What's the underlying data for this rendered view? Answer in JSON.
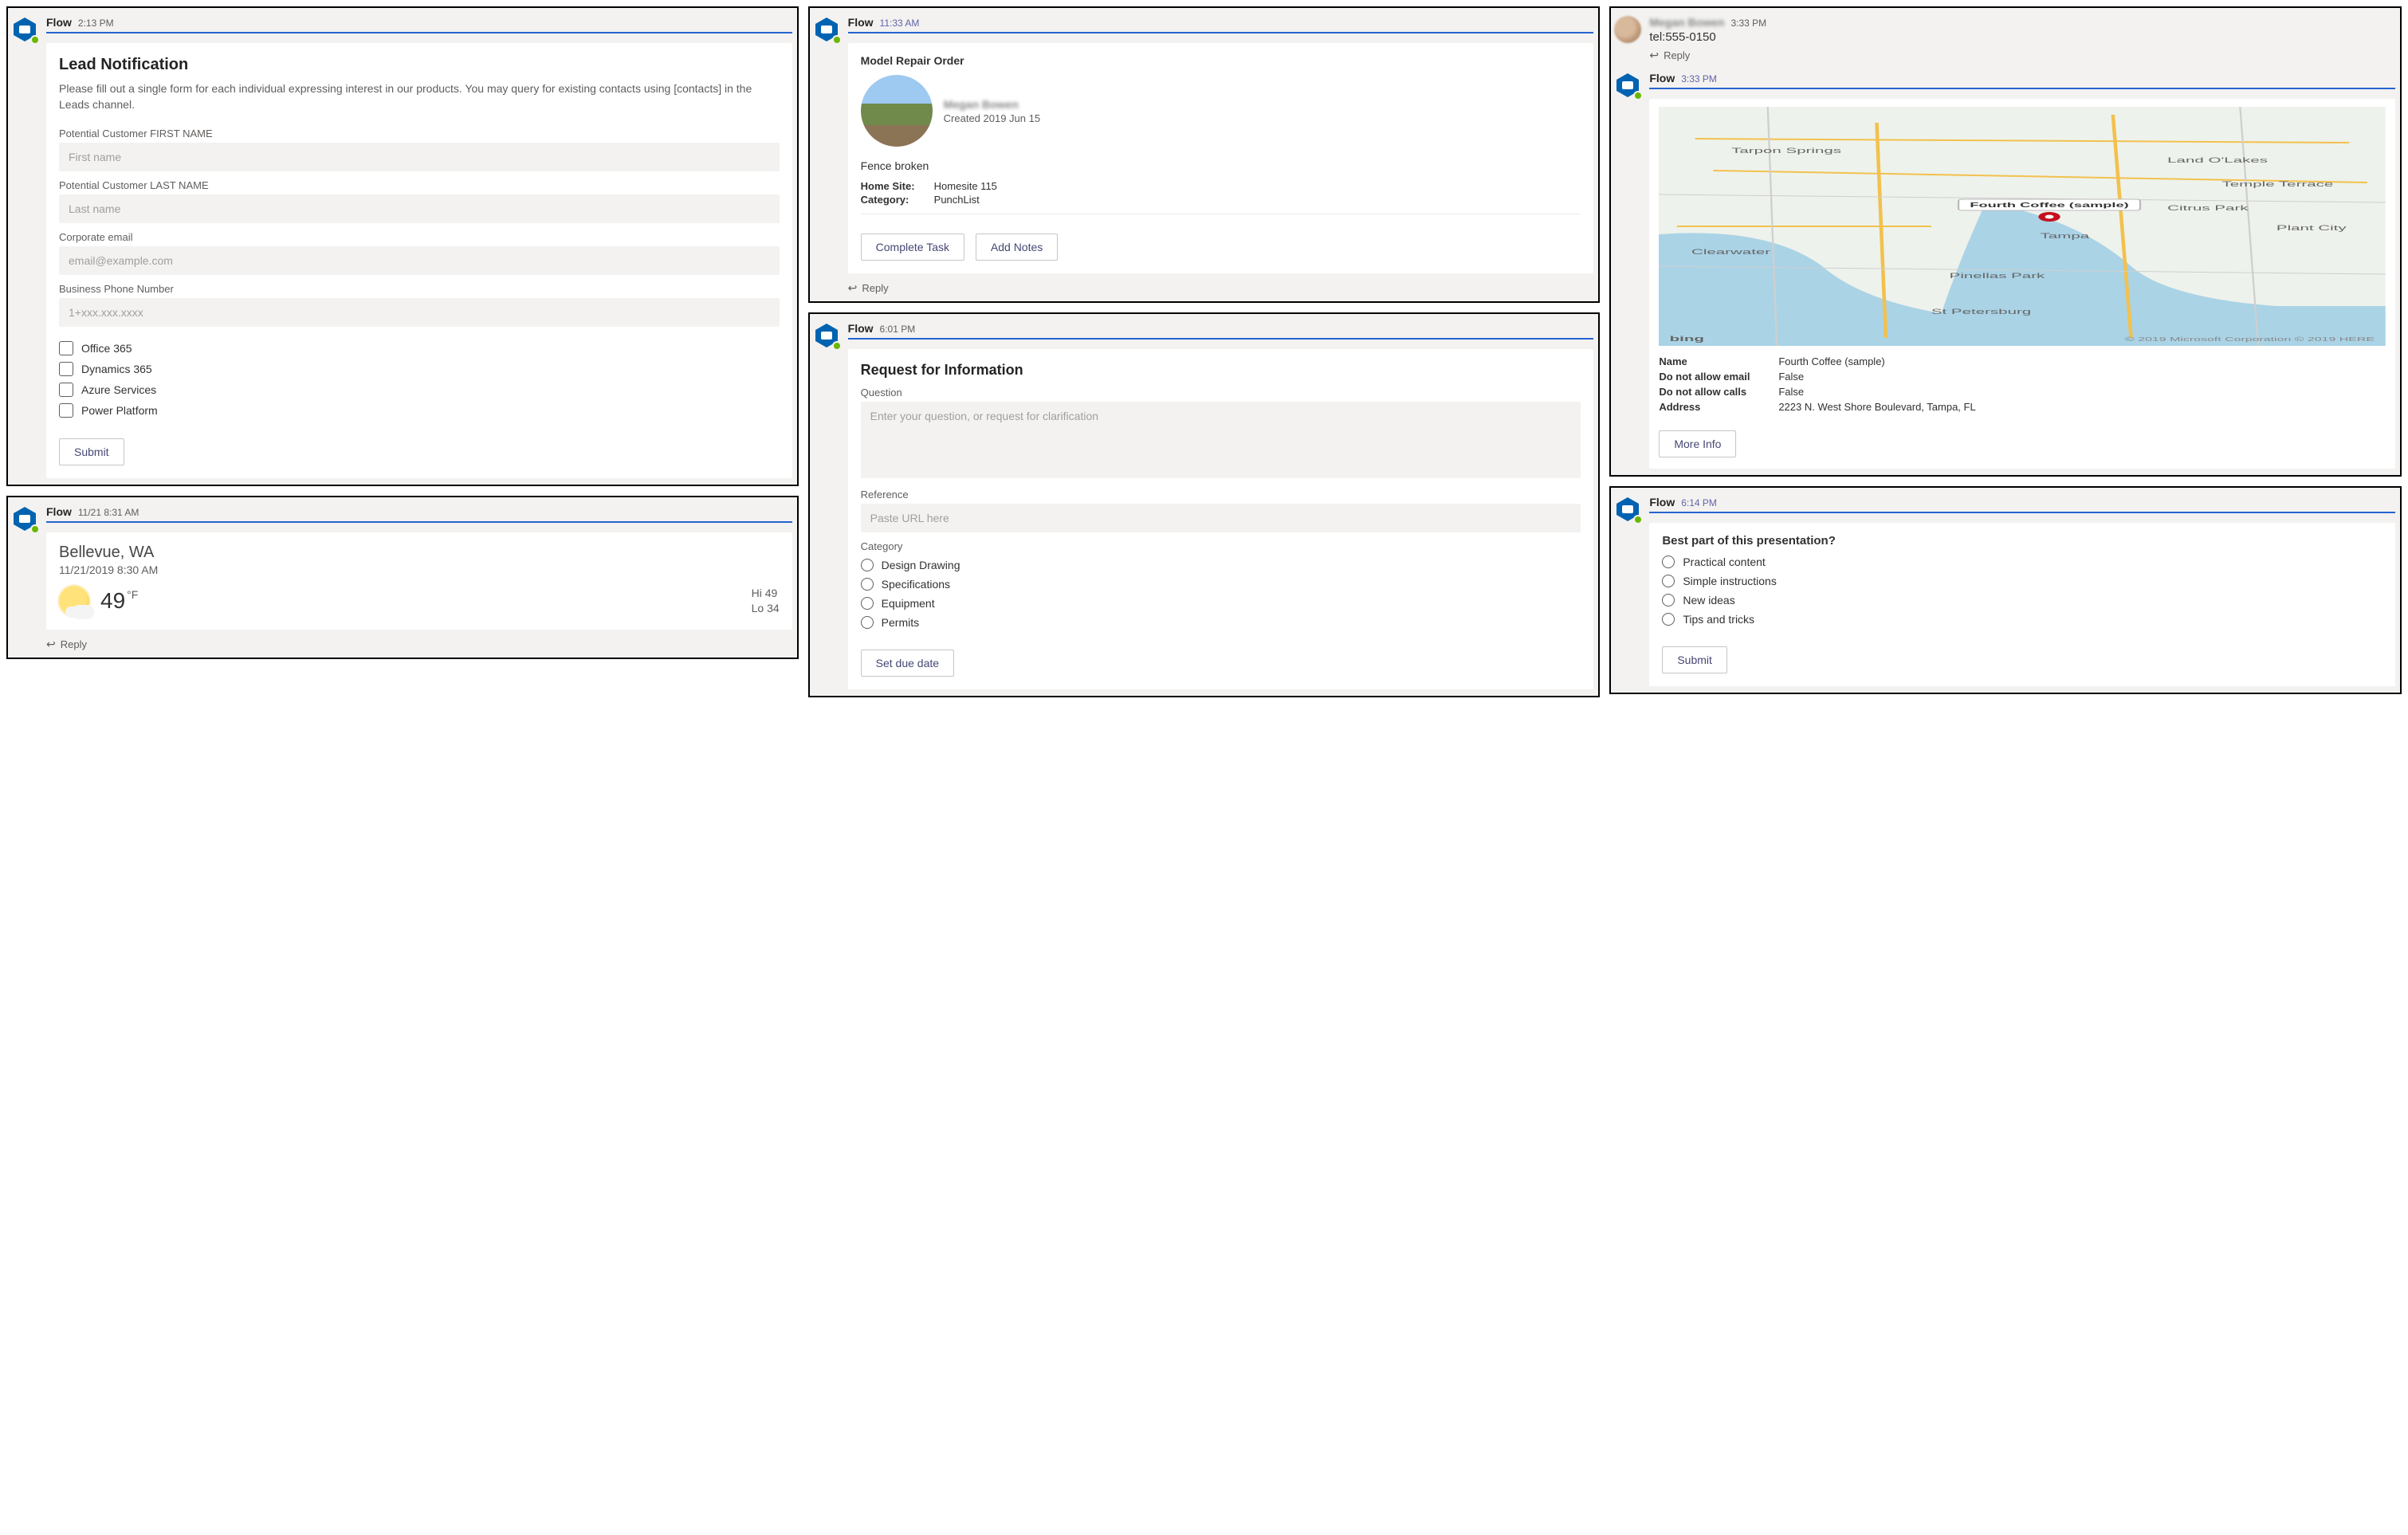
{
  "flow_label": "Flow",
  "reply_label": "Reply",
  "card1": {
    "time": "2:13 PM",
    "title": "Lead Notification",
    "desc": "Please fill out a single form for each individual expressing interest in our products. You may query for existing contacts using [contacts] in the Leads channel.",
    "labels": {
      "first": "Potential Customer FIRST NAME",
      "last": "Potential Customer LAST NAME",
      "email": "Corporate email",
      "phone": "Business Phone Number"
    },
    "placeholders": {
      "first": "First name",
      "last": "Last name",
      "email": "email@example.com",
      "phone": "1+xxx.xxx.xxxx"
    },
    "checks": [
      "Office 365",
      "Dynamics 365",
      "Azure Services",
      "Power Platform"
    ],
    "submit": "Submit"
  },
  "card2": {
    "time": "11/21 8:31 AM",
    "location": "Bellevue, WA",
    "datetime": "11/21/2019 8:30 AM",
    "temp": "49",
    "unit": "°F",
    "hi": "Hi 49",
    "lo": "Lo 34"
  },
  "card3": {
    "time": "11:33 AM",
    "title": "Model Repair Order",
    "creator": "Megan Bowen",
    "created": "Created 2019 Jun 15",
    "issue": "Fence broken",
    "homesite_k": "Home Site:",
    "homesite_v": "Homesite 115",
    "category_k": "Category:",
    "category_v": "PunchList",
    "btn_complete": "Complete Task",
    "btn_notes": "Add Notes"
  },
  "card4": {
    "time": "6:01 PM",
    "title": "Request for Information",
    "question_label": "Question",
    "question_ph": "Enter your question, or request for clarification",
    "reference_label": "Reference",
    "reference_ph": "Paste URL here",
    "category_label": "Category",
    "radios": [
      "Design Drawing",
      "Specifications",
      "Equipment",
      "Permits"
    ],
    "btn_due": "Set due date"
  },
  "card5a": {
    "sender": "Megan Bowen",
    "time": "3:33 PM",
    "tel": "tel:555-0150"
  },
  "card5b": {
    "time": "3:33 PM",
    "map_attribution_left": "bing",
    "map_attribution_right": "© 2019 Microsoft Corporation © 2019 HERE",
    "pin_label": "Fourth Coffee (sample)",
    "rows": [
      {
        "k": "Name",
        "v": "Fourth Coffee (sample)"
      },
      {
        "k": "Do not allow email",
        "v": "False"
      },
      {
        "k": "Do not allow calls",
        "v": "False"
      },
      {
        "k": "Address",
        "v": "2223 N. West Shore Boulevard, Tampa, FL"
      }
    ],
    "btn_more": "More Info"
  },
  "card6": {
    "time": "6:14 PM",
    "title": "Best part of this presentation?",
    "radios": [
      "Practical content",
      "Simple instructions",
      "New ideas",
      "Tips and tricks"
    ],
    "submit": "Submit"
  }
}
